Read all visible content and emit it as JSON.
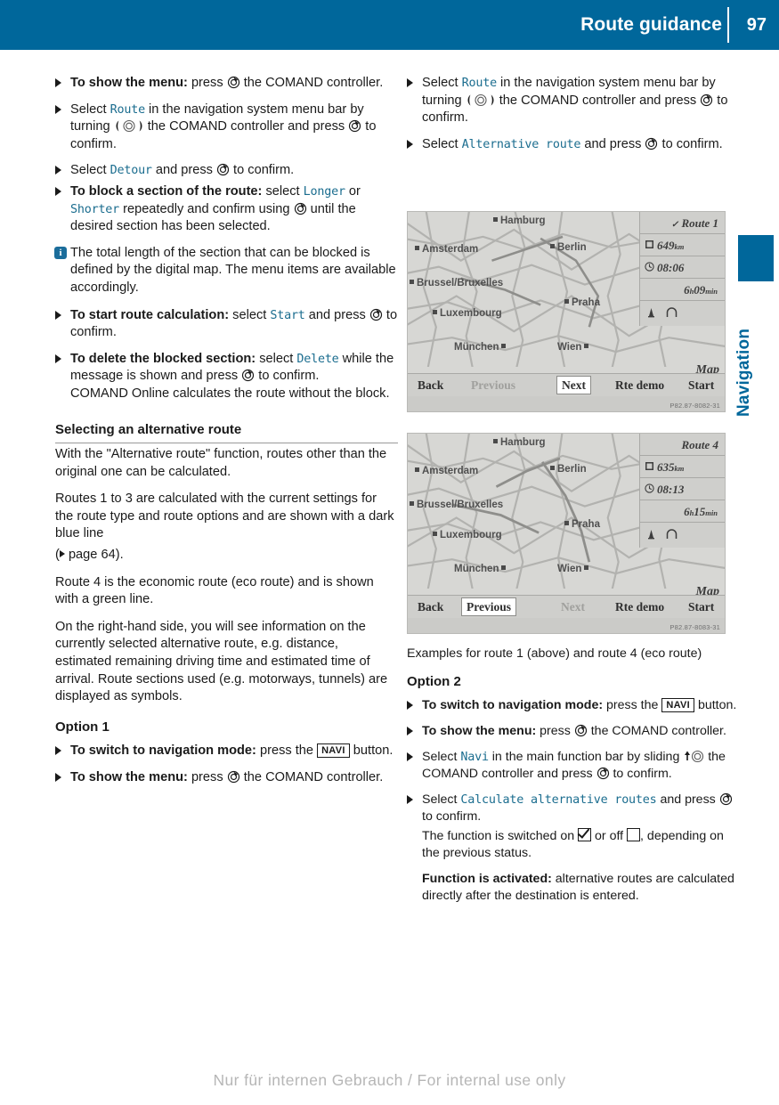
{
  "header": {
    "title": "Route guidance",
    "page_number": "97",
    "accent_color": "#00679b"
  },
  "margin_tab": {
    "label": "Navigation"
  },
  "left_column": {
    "items": [
      {
        "type": "bullet",
        "lead": "To show the menu:",
        "text_a": " press ",
        "icon": "press-controller-icon",
        "text_b": " the COMAND controller."
      },
      {
        "type": "bullet",
        "text_a": "Select ",
        "code_a": "Route",
        "text_b": " in the navigation system menu bar by turning ",
        "icon": "turn-controller-icon",
        "text_c": " the COMAND controller and press ",
        "icon2": "press-controller-icon",
        "text_d": " to confirm."
      },
      {
        "type": "bullet",
        "text_a": "Select ",
        "code_a": "Detour",
        "text_b": " and press ",
        "icon": "press-controller-icon",
        "text_c": " to confirm."
      },
      {
        "type": "bullet",
        "lead": "To block a section of the route:",
        "text_a": " select ",
        "code_a": "Longer",
        "text_b": " or ",
        "code_b": "Shorter",
        "text_c": " repeatedly and confirm using ",
        "icon": "press-controller-icon",
        "text_d": " until the desired section has been selected."
      },
      {
        "type": "note",
        "icon": "info-icon",
        "text": "The total length of the section that can be blocked is defined by the digital map. The menu items are available accordingly."
      },
      {
        "type": "bullet",
        "lead": "To start route calculation:",
        "text_a": " select ",
        "code_a": "Start",
        "text_b": " and press ",
        "icon": "press-controller-icon",
        "text_c": " to confirm."
      },
      {
        "type": "bullet",
        "lead": "To delete the blocked section:",
        "text_a": " select ",
        "code_a": "Delete",
        "text_b": " while the message is shown and press ",
        "icon": "press-controller-icon",
        "text_c": " to confirm.",
        "followup": "COMAND Online calculates the route without the block."
      }
    ],
    "section_heading": "Selecting an alternative route",
    "paragraphs": [
      "With the \"Alternative route\" function, routes other than the original one can be calculated.",
      "Routes 1 to 3 are calculated with the current settings for the route type and route options and are shown with a dark blue line",
      "Route 4 is the economic route (eco route) and is shown with a green line.",
      "On the right-hand side, you will see information on the currently selected alternative route, e.g. distance, estimated remaining driving time and estimated time of arrival. Route sections used (e.g. motorways, tunnels) are displayed as symbols."
    ],
    "page_ref": "page 64",
    "option1_heading": "Option 1",
    "option1_items": [
      {
        "lead": "To switch to navigation mode:",
        "text_a": " press the ",
        "button": "NAVI",
        "text_b": " button."
      },
      {
        "lead": "To show the menu:",
        "text_a": " press ",
        "icon": "press-controller-icon",
        "text_b": " the COMAND controller."
      }
    ]
  },
  "right_column": {
    "items": [
      {
        "type": "bullet",
        "text_a": "Select ",
        "code_a": "Route",
        "text_b": " in the navigation system menu bar by turning ",
        "icon": "turn-controller-icon",
        "text_c": " the COMAND controller and press ",
        "icon2": "press-controller-icon",
        "text_d": " to confirm."
      },
      {
        "type": "bullet",
        "text_a": "Select ",
        "code_a": "Alternative route",
        "text_b": " and press ",
        "icon": "press-controller-icon",
        "text_c": " to confirm."
      }
    ],
    "caption": "Examples for route 1 (above) and route 4 (eco route)",
    "option2_heading": "Option 2",
    "option2_items": [
      {
        "lead": "To switch to navigation mode:",
        "text_a": " press the ",
        "button": "NAVI",
        "text_b": " button."
      },
      {
        "lead": "To show the menu:",
        "text_a": " press ",
        "icon": "press-controller-icon",
        "text_b": " the COMAND controller."
      },
      {
        "text_a": "Select ",
        "code_a": "Navi",
        "text_b": " in the main function bar by sliding ",
        "icon": "slide-controller-icon",
        "text_c": " the COMAND controller and press ",
        "icon2": "press-controller-icon",
        "text_d": " to confirm."
      },
      {
        "text_a": "Select ",
        "code_a": "Calculate alternative routes",
        "text_b": " and press ",
        "icon": "press-controller-icon",
        "text_c": " to confirm."
      }
    ],
    "status_line_a": "The function is switched on ",
    "status_line_b": " or off ",
    "status_line_c": ", depending on the previous status.",
    "activated_lead": "Function is activated:",
    "activated_text": " alternative routes are calculated directly after the destination is entered."
  },
  "screenshots": [
    {
      "route_title": "Route 1",
      "selected_marker": "checkmark",
      "distance": "649",
      "distance_unit": "km",
      "arrival_time": "08:06",
      "driving_time_h": "6",
      "driving_time_h_unit": "h",
      "driving_time_m": "09",
      "driving_time_m_unit": "min",
      "map_label": "Map",
      "cities": [
        "Hamburg",
        "Amsterdam",
        "Berlin",
        "Brussel/Bruxelles",
        "Praha",
        "Luxembourg",
        "München",
        "Wien"
      ],
      "buttons": [
        {
          "label": "Back",
          "state": "normal"
        },
        {
          "label": "Previous",
          "state": "disabled"
        },
        {
          "label": "Next",
          "state": "selected"
        },
        {
          "label": "Rte demo",
          "state": "normal"
        },
        {
          "label": "Start",
          "state": "normal"
        }
      ],
      "image_code": "P82.87-8082-31"
    },
    {
      "route_title": "Route 4",
      "selected_marker": "none",
      "distance": "635",
      "distance_unit": "km",
      "arrival_time": "08:13",
      "driving_time_h": "6",
      "driving_time_h_unit": "h",
      "driving_time_m": "15",
      "driving_time_m_unit": "min",
      "map_label": "Map",
      "cities": [
        "Hamburg",
        "Amsterdam",
        "Berlin",
        "Brussel/Bruxelles",
        "Praha",
        "Luxembourg",
        "München",
        "Wien"
      ],
      "buttons": [
        {
          "label": "Back",
          "state": "normal"
        },
        {
          "label": "Previous",
          "state": "selected"
        },
        {
          "label": "Next",
          "state": "disabled"
        },
        {
          "label": "Rte demo",
          "state": "normal"
        },
        {
          "label": "Start",
          "state": "normal"
        }
      ],
      "image_code": "P82.87-8083-31"
    }
  ],
  "footer": {
    "watermark": "Nur für internen Gebrauch / For internal use only"
  }
}
